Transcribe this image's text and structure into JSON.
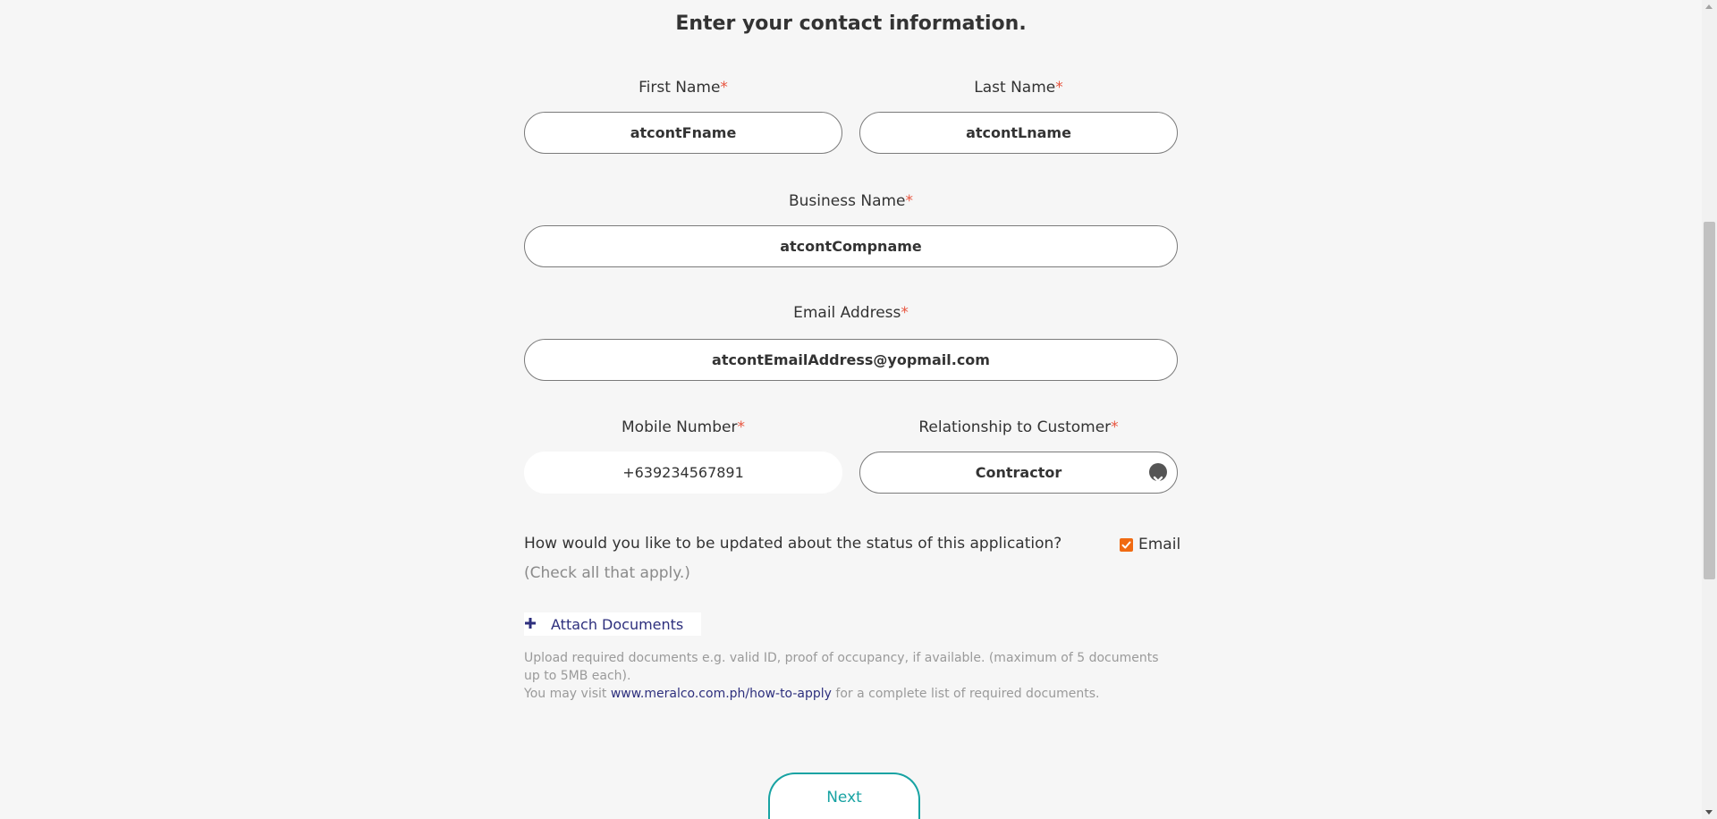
{
  "title": "Enter your contact information.",
  "required_marker": "*",
  "first_name": {
    "label": "First Name",
    "value": "atcontFname"
  },
  "last_name": {
    "label": "Last Name",
    "value": "atcontLname"
  },
  "business_name": {
    "label": "Business Name",
    "value": "atcontCompname"
  },
  "email": {
    "label": "Email Address",
    "value": "atcontEmailAddress@yopmail.com"
  },
  "mobile": {
    "label": "Mobile Number",
    "value": "+639234567891"
  },
  "relationship": {
    "label": "Relationship to Customer",
    "value": "Contractor"
  },
  "updates": {
    "question": "How would you like to be updated about the status of this application?",
    "hint": "(Check all that apply.)",
    "email_option": "Email",
    "email_checked": true
  },
  "attach": {
    "icon": "plus-icon",
    "label": "Attach Documents"
  },
  "helper": {
    "line1": "Upload required documents e.g. valid ID, proof of occupancy, if available. (maximum of 5 documents up to 5MB each).",
    "line2_prefix": "You may visit",
    "link": "www.meralco.com.ph/how-to-apply",
    "line2_suffix": "for a complete list of required documents."
  },
  "next_label": "Next",
  "colors": {
    "required": "#e8553f",
    "checkbox": "#f06a12",
    "link": "#2d2f7d",
    "next": "#18a3a3"
  }
}
